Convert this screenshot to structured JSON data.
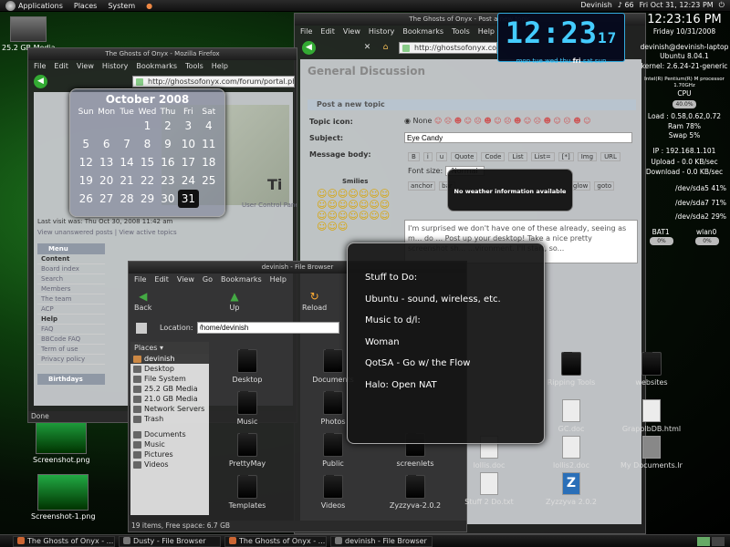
{
  "top_panel": {
    "menus": [
      "Applications",
      "Places",
      "System"
    ],
    "clock": "Fri Oct 31, 12:23 PM",
    "user": "Devinish",
    "volume": "66"
  },
  "desktop_icons": [
    {
      "label": "Screenshot.png"
    },
    {
      "label": "Screenshot-1.png"
    },
    {
      "label": "25.2 GB Media"
    }
  ],
  "browser_left": {
    "title": "The Ghosts of Onyx - Mozilla Firefox",
    "menus": [
      "File",
      "Edit",
      "View",
      "History",
      "Bookmarks",
      "Tools",
      "Help"
    ],
    "url": "http://ghostsofonyx.com/forum/portal.php",
    "last_visit": "Last visit was: Thu Oct 30, 2008 11:42 am",
    "links": "View unanswered posts | View active topics",
    "menu_head": "Menu",
    "menu_items": [
      "Content",
      "Board index",
      "Search",
      "Members",
      "The team",
      "ACP",
      "Help",
      "FAQ",
      "BBCode FAQ",
      "Term of use",
      "Privacy policy"
    ],
    "birthdays": "Birthdays",
    "ucp": "User Control Panel",
    "status": "Done"
  },
  "browser_right": {
    "title": "The Ghosts of Onyx - Post a new topic",
    "menus": [
      "File",
      "Edit",
      "View",
      "History",
      "Bookmarks",
      "Tools",
      "Help"
    ],
    "url": "http://ghostsofonyx.com",
    "heading": "General Discussion",
    "post_header": "Post a new topic",
    "topic_icon": "Topic icon:",
    "none": "None",
    "subject_label": "Subject:",
    "subject_value": "Eye Candy",
    "body_label": "Message body:",
    "smilies": "Smilies",
    "toolbar_btns": [
      "B",
      "i",
      "u",
      "Quote",
      "Code",
      "List",
      "List=",
      "[*]",
      "Img",
      "URL"
    ],
    "font_size": "Font size:",
    "font_value": "Normal",
    "extra_btns": [
      "anchor",
      "bar",
      "glow",
      "goto"
    ],
    "body_text": "I'm surprised we don't have one of these already, seeing as m... do ... Post up your desktop! Take a nice pretty screenshot sh... ...vironment. I'll start, so..."
  },
  "calendar": {
    "title": "October 2008",
    "day_names": [
      "Sun",
      "Mon",
      "Tue",
      "Wed",
      "Thu",
      "Fri",
      "Sat"
    ],
    "first_weekday": 3,
    "days_in_month": 31,
    "today": 31
  },
  "weather": {
    "text": "No weather information available"
  },
  "big_clock": {
    "time": "12:23",
    "seconds": "17",
    "days": [
      "mon",
      "tue",
      "wed",
      "thu",
      "fri",
      "sat",
      "sun"
    ],
    "active_day": "fri"
  },
  "conky": {
    "time": "12:23:16 PM",
    "date": "Friday 10/31/2008",
    "host": "devinish@devinish-laptop",
    "os": "Ubuntu 8.04.1",
    "kernel": "kernel: 2.6.24-21-generic",
    "cpu_name": "Intel(R) Pentium(R) M processor 1.70GHz",
    "cpu_label": "CPU",
    "cpu": "40.0%",
    "load": "Load : 0.58,0.62,0.72",
    "ram": "Ram 78%",
    "swap": "Swap 5%",
    "ip": "IP : 192.168.1.101",
    "upload": "Upload - 0.0 KB/sec",
    "download": "Download - 0.0 KB/sec",
    "disks": [
      "/dev/sda5 41%",
      "/dev/sda7 71%",
      "/dev/sda2 29%"
    ],
    "bat_label": "BAT1",
    "bat": "0%",
    "wlan_label": "wlan0",
    "wlan": "0%"
  },
  "file_browser": {
    "title": "devinish - File Browser",
    "menus": [
      "File",
      "Edit",
      "View",
      "Go",
      "Bookmarks",
      "Help"
    ],
    "toolbar": [
      "Back",
      "Up",
      "Reload"
    ],
    "location_label": "Location:",
    "location": "/home/devinish",
    "places_label": "Places",
    "places": [
      "devinish",
      "Desktop",
      "File System",
      "25.2 GB Media",
      "21.0 GB Media",
      "Network Servers",
      "Trash",
      "Documents",
      "Music",
      "Pictures",
      "Videos"
    ],
    "files": [
      "Desktop",
      "Documents",
      "Music",
      "Photos",
      "PrettyMay",
      "Public",
      "screenlets",
      "Templates",
      "Videos",
      "Zyzzyva-2.0.2"
    ],
    "right_files": [
      "Ripping Tools",
      "websites",
      "GC.doc",
      "GrapplbDB.html",
      "lollis.doc",
      "lollis2.doc",
      "My Documents.lnk",
      "Stuff 2 Do.txt",
      "Zyzzyva 2.0.2"
    ],
    "status": "19 items, Free space: 6.7 GB"
  },
  "todo": {
    "lines": [
      "Stuff to Do:",
      "Ubuntu - sound, wireless, etc.",
      "Music to d/l:",
      "Woman",
      "QotSA - Go w/ the Flow",
      "Halo: Open NAT"
    ]
  },
  "taskbar": [
    "The Ghosts of Onyx - ...",
    "Dusty - File Browser",
    "The Ghosts of Onyx - ...",
    "devinish - File Browser"
  ],
  "colors": {
    "accent_green": "#1f7a1f",
    "clock_cyan": "#44ccff"
  }
}
